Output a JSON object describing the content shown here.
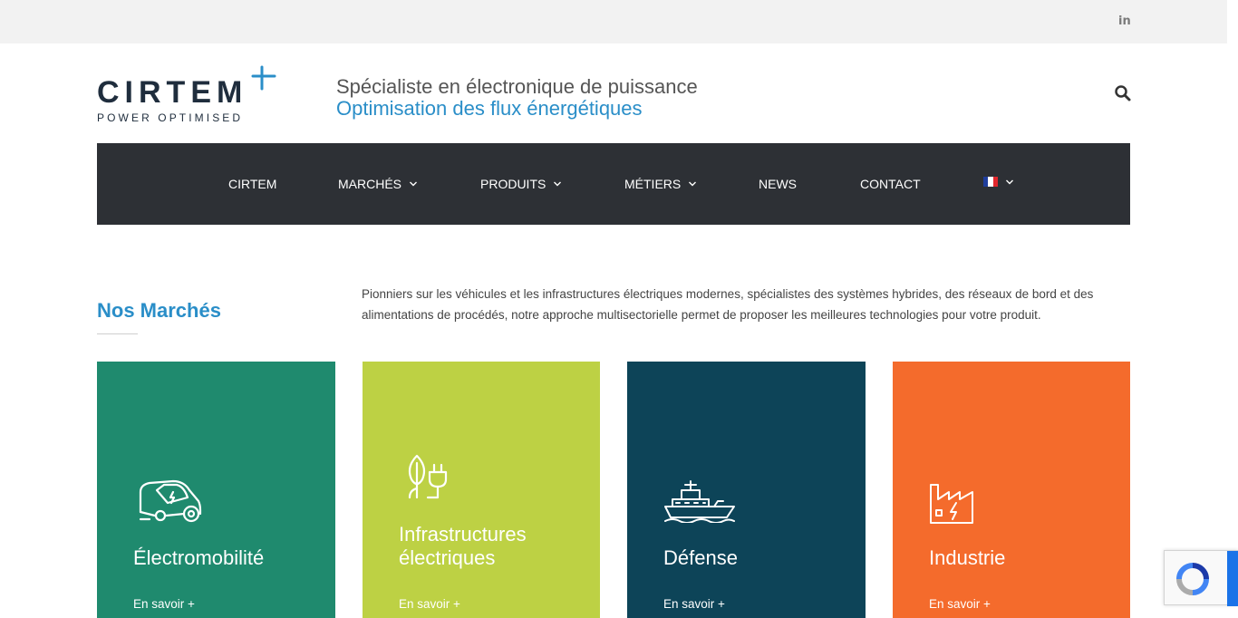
{
  "topbar": {
    "social_icon": "linkedin-icon",
    "social_label": "in"
  },
  "header": {
    "logo_text": "CIRTEM",
    "logo_plus": "+",
    "logo_sub": "POWER OPTIMISED",
    "tagline_line1": "Spécialiste en électronique de puissance",
    "tagline_line2": "Optimisation des flux énergétiques",
    "search_icon": "search-icon"
  },
  "nav": {
    "items": [
      {
        "label": "CIRTEM",
        "has_dropdown": false
      },
      {
        "label": "MARCHÉS",
        "has_dropdown": true
      },
      {
        "label": "PRODUITS",
        "has_dropdown": true
      },
      {
        "label": "MÉTIERS",
        "has_dropdown": true
      },
      {
        "label": "NEWS",
        "has_dropdown": false
      },
      {
        "label": "CONTACT",
        "has_dropdown": false
      }
    ],
    "language_icon": "french-flag-icon"
  },
  "section": {
    "title": "Nos Marchés",
    "intro": "Pionniers sur les véhicules et les infrastructures électriques modernes, spécialistes des systèmes hybrides, des réseaux de bord et des alimentations de procédés, notre approche multisectorielle permet de proposer les meilleures technologies pour votre produit."
  },
  "cards": [
    {
      "title_line1": "Électromobilité",
      "title_line2": "",
      "more": "En savoir +",
      "color": "#1f8a6e",
      "icon": "electric-car-icon"
    },
    {
      "title_line1": "Infrastructures",
      "title_line2": "électriques",
      "more": "En savoir +",
      "color": "#bdd144",
      "icon": "plug-leaf-icon"
    },
    {
      "title_line1": "Défense",
      "title_line2": "",
      "more": "En savoir +",
      "color": "#0d4458",
      "icon": "ship-icon"
    },
    {
      "title_line1": "Industrie",
      "title_line2": "",
      "more": "En savoir +",
      "color": "#f46b2c",
      "icon": "factory-icon"
    }
  ],
  "colors": {
    "brand_blue": "#2a8ec8",
    "nav_bg": "#2d3035",
    "logo_dark": "#1f2d3d"
  }
}
